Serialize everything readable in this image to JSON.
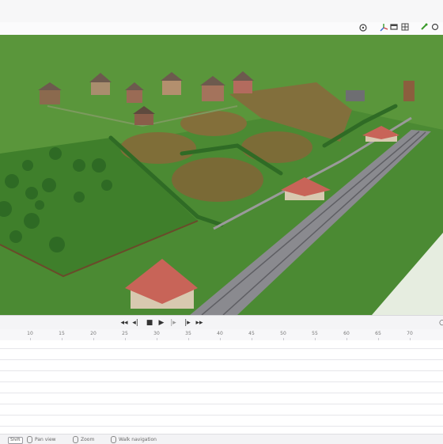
{
  "toolbar": {
    "icons": [
      "pivot-icon",
      "gizmo-icon",
      "viewport-shading-icon",
      "grid-icon",
      "snap-icon",
      "render-icon"
    ]
  },
  "playback": {
    "buttons": [
      "jump-to-start",
      "previous-keyframe",
      "step-back",
      "stop",
      "play",
      "step-forward",
      "next-keyframe",
      "jump-to-end"
    ],
    "glyphs": [
      "|◀◀",
      "◀|",
      "◀|",
      "■",
      "▶",
      "|▶",
      "|▶",
      "▶▶|"
    ]
  },
  "timeline": {
    "ticks": [
      "10",
      "15",
      "20",
      "25",
      "30",
      "35",
      "40",
      "45",
      "50",
      "55",
      "60",
      "65",
      "70"
    ]
  },
  "status": {
    "shift_key": "Shift",
    "pan": "Pan view",
    "zoom": "Zoom",
    "walk": "Walk navigation"
  },
  "colors": {
    "grass": "#4b8a33",
    "field": "#7a6a36",
    "road": "#8a8a8f",
    "roof": "#c86458"
  }
}
